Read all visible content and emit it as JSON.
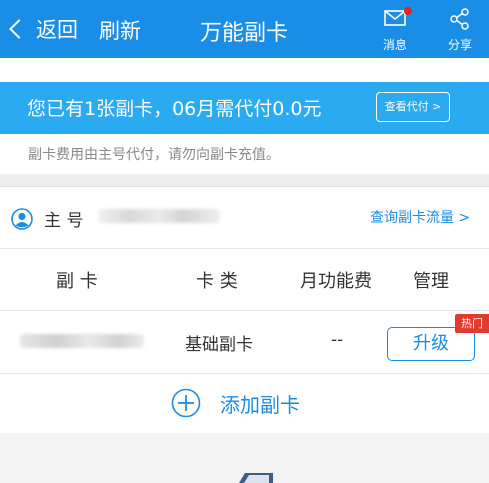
{
  "header": {
    "back_label": "返回",
    "refresh_label": "刷新",
    "title": "万能副卡",
    "message_label": "消息",
    "share_label": "分享"
  },
  "banner": {
    "text": "您已有1张副卡，06月需代付0.0元",
    "view_button": "查看代付 >"
  },
  "notice": {
    "text": "副卡费用由主号代付，请勿向副卡充值。"
  },
  "main_number": {
    "label": "主  号",
    "query_link": "查询副卡流量 >"
  },
  "table": {
    "headers": [
      "副  卡",
      "卡  类",
      "月功能费",
      "管理"
    ],
    "rows": [
      {
        "card_type": "基础副卡",
        "monthly_fee": "--",
        "action": "升级",
        "badge": "热门"
      }
    ]
  },
  "add_card": {
    "label": "添加副卡"
  },
  "colors": {
    "primary": "#1a8ee6",
    "banner": "#2aaaf0",
    "badge": "#e23a2c",
    "background": "#eeeeee"
  },
  "icons": {
    "back": "chevron-left-icon",
    "message": "envelope-icon",
    "share": "share-icon",
    "user": "user-icon",
    "add": "plus-circle-icon"
  }
}
